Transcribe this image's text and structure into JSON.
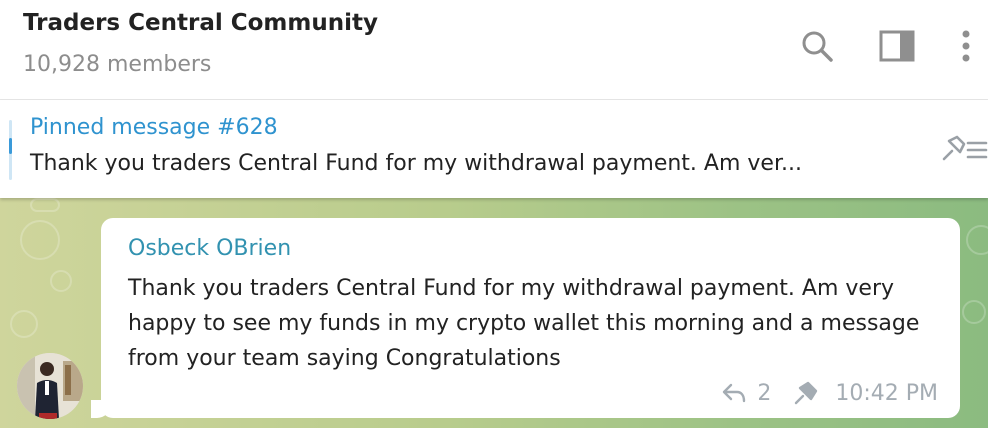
{
  "header": {
    "title": "Traders Central Community",
    "subtitle": "10,928 members",
    "icons": [
      "search-icon",
      "sidebar-toggle-icon",
      "more-vertical-icon"
    ]
  },
  "pinned": {
    "title": "Pinned message #628",
    "text": "Thank you traders Central Fund  for my withdrawal payment. Am ver...",
    "icon": "pin-list-icon",
    "accent": "#2f93cf"
  },
  "message": {
    "sender": "Osbeck OBrien",
    "text": "Thank you traders Central Fund  for my withdrawal payment. Am very happy to see my funds in my crypto wallet this morning and a message from your team saying Congratulations",
    "reply_count": "2",
    "time": "10:42 PM",
    "icons": [
      "reply-icon",
      "pin-icon"
    ],
    "sender_color": "#3292b0"
  },
  "colors": {
    "wallpaper_start": "#cfd59c",
    "wallpaper_end": "#8bbb80",
    "meta": "#a4acb3"
  }
}
